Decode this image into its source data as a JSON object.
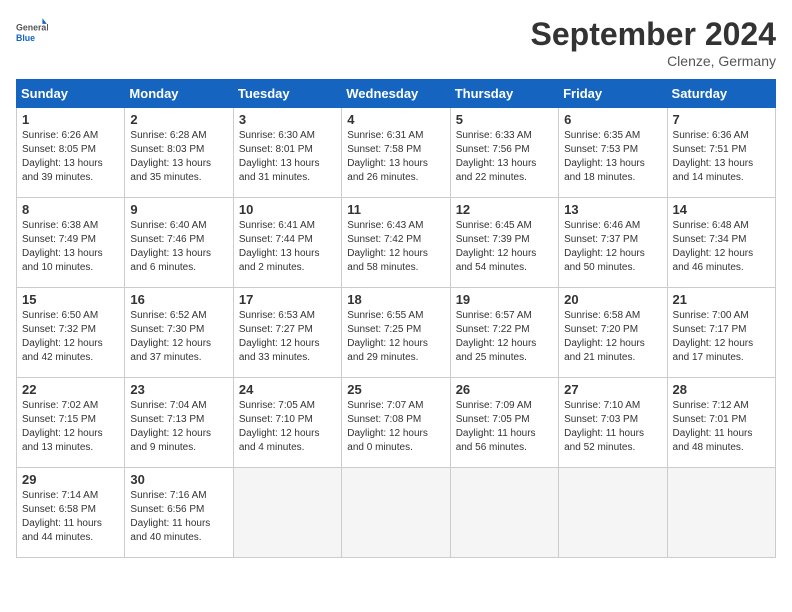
{
  "header": {
    "logo_general": "General",
    "logo_blue": "Blue",
    "month_title": "September 2024",
    "subtitle": "Clenze, Germany"
  },
  "days_of_week": [
    "Sunday",
    "Monday",
    "Tuesday",
    "Wednesday",
    "Thursday",
    "Friday",
    "Saturday"
  ],
  "weeks": [
    [
      {
        "day": 1,
        "sunrise": "6:26 AM",
        "sunset": "8:05 PM",
        "daylight": "13 hours and 39 minutes."
      },
      {
        "day": 2,
        "sunrise": "6:28 AM",
        "sunset": "8:03 PM",
        "daylight": "13 hours and 35 minutes."
      },
      {
        "day": 3,
        "sunrise": "6:30 AM",
        "sunset": "8:01 PM",
        "daylight": "13 hours and 31 minutes."
      },
      {
        "day": 4,
        "sunrise": "6:31 AM",
        "sunset": "7:58 PM",
        "daylight": "13 hours and 26 minutes."
      },
      {
        "day": 5,
        "sunrise": "6:33 AM",
        "sunset": "7:56 PM",
        "daylight": "13 hours and 22 minutes."
      },
      {
        "day": 6,
        "sunrise": "6:35 AM",
        "sunset": "7:53 PM",
        "daylight": "13 hours and 18 minutes."
      },
      {
        "day": 7,
        "sunrise": "6:36 AM",
        "sunset": "7:51 PM",
        "daylight": "13 hours and 14 minutes."
      }
    ],
    [
      {
        "day": 8,
        "sunrise": "6:38 AM",
        "sunset": "7:49 PM",
        "daylight": "13 hours and 10 minutes."
      },
      {
        "day": 9,
        "sunrise": "6:40 AM",
        "sunset": "7:46 PM",
        "daylight": "13 hours and 6 minutes."
      },
      {
        "day": 10,
        "sunrise": "6:41 AM",
        "sunset": "7:44 PM",
        "daylight": "13 hours and 2 minutes."
      },
      {
        "day": 11,
        "sunrise": "6:43 AM",
        "sunset": "7:42 PM",
        "daylight": "12 hours and 58 minutes."
      },
      {
        "day": 12,
        "sunrise": "6:45 AM",
        "sunset": "7:39 PM",
        "daylight": "12 hours and 54 minutes."
      },
      {
        "day": 13,
        "sunrise": "6:46 AM",
        "sunset": "7:37 PM",
        "daylight": "12 hours and 50 minutes."
      },
      {
        "day": 14,
        "sunrise": "6:48 AM",
        "sunset": "7:34 PM",
        "daylight": "12 hours and 46 minutes."
      }
    ],
    [
      {
        "day": 15,
        "sunrise": "6:50 AM",
        "sunset": "7:32 PM",
        "daylight": "12 hours and 42 minutes."
      },
      {
        "day": 16,
        "sunrise": "6:52 AM",
        "sunset": "7:30 PM",
        "daylight": "12 hours and 37 minutes."
      },
      {
        "day": 17,
        "sunrise": "6:53 AM",
        "sunset": "7:27 PM",
        "daylight": "12 hours and 33 minutes."
      },
      {
        "day": 18,
        "sunrise": "6:55 AM",
        "sunset": "7:25 PM",
        "daylight": "12 hours and 29 minutes."
      },
      {
        "day": 19,
        "sunrise": "6:57 AM",
        "sunset": "7:22 PM",
        "daylight": "12 hours and 25 minutes."
      },
      {
        "day": 20,
        "sunrise": "6:58 AM",
        "sunset": "7:20 PM",
        "daylight": "12 hours and 21 minutes."
      },
      {
        "day": 21,
        "sunrise": "7:00 AM",
        "sunset": "7:17 PM",
        "daylight": "12 hours and 17 minutes."
      }
    ],
    [
      {
        "day": 22,
        "sunrise": "7:02 AM",
        "sunset": "7:15 PM",
        "daylight": "12 hours and 13 minutes."
      },
      {
        "day": 23,
        "sunrise": "7:04 AM",
        "sunset": "7:13 PM",
        "daylight": "12 hours and 9 minutes."
      },
      {
        "day": 24,
        "sunrise": "7:05 AM",
        "sunset": "7:10 PM",
        "daylight": "12 hours and 4 minutes."
      },
      {
        "day": 25,
        "sunrise": "7:07 AM",
        "sunset": "7:08 PM",
        "daylight": "12 hours and 0 minutes."
      },
      {
        "day": 26,
        "sunrise": "7:09 AM",
        "sunset": "7:05 PM",
        "daylight": "11 hours and 56 minutes."
      },
      {
        "day": 27,
        "sunrise": "7:10 AM",
        "sunset": "7:03 PM",
        "daylight": "11 hours and 52 minutes."
      },
      {
        "day": 28,
        "sunrise": "7:12 AM",
        "sunset": "7:01 PM",
        "daylight": "11 hours and 48 minutes."
      }
    ],
    [
      {
        "day": 29,
        "sunrise": "7:14 AM",
        "sunset": "6:58 PM",
        "daylight": "11 hours and 44 minutes."
      },
      {
        "day": 30,
        "sunrise": "7:16 AM",
        "sunset": "6:56 PM",
        "daylight": "11 hours and 40 minutes."
      },
      null,
      null,
      null,
      null,
      null
    ]
  ]
}
